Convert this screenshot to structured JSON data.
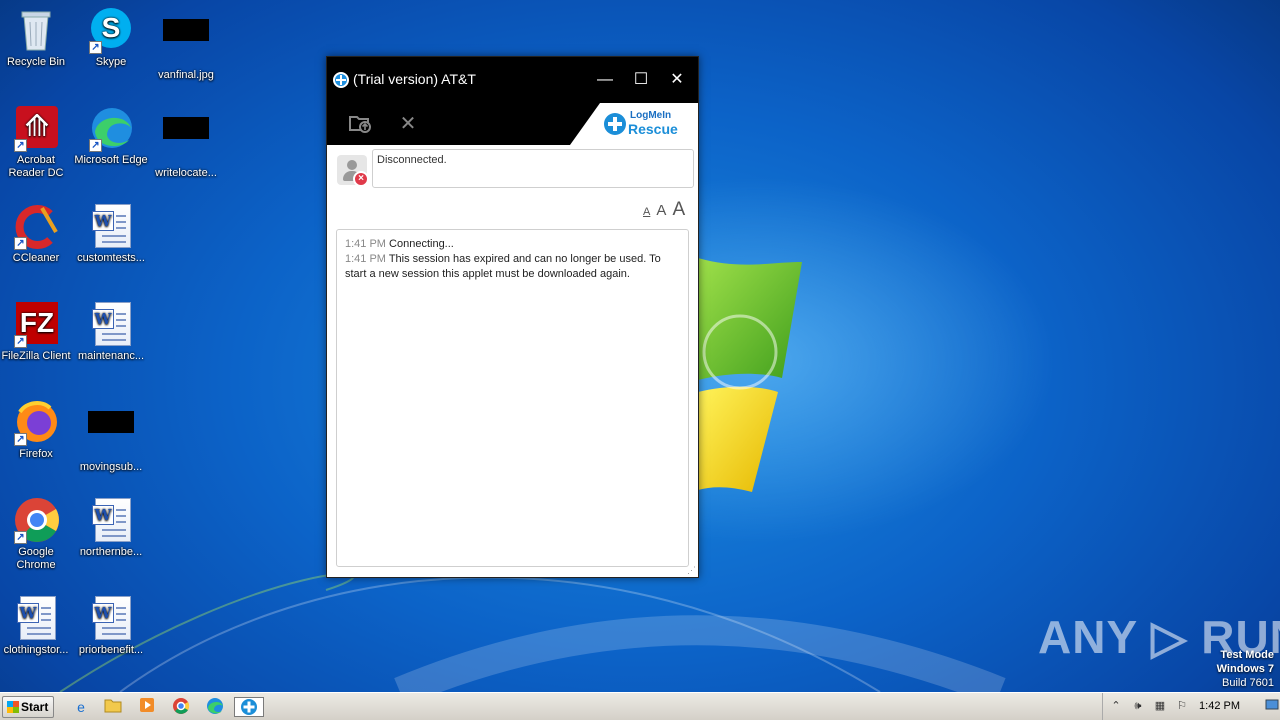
{
  "desktop": {
    "icons": [
      {
        "label": "Recycle Bin"
      },
      {
        "label": "Skype"
      },
      {
        "label": "vanfinal.jpg"
      },
      {
        "label": "Acrobat Reader DC"
      },
      {
        "label": "Microsoft Edge"
      },
      {
        "label": "writelocate..."
      },
      {
        "label": "CCleaner"
      },
      {
        "label": "customtests..."
      },
      {
        "label": "FileZilla Client"
      },
      {
        "label": "maintenanc..."
      },
      {
        "label": "Firefox"
      },
      {
        "label": "movingsub..."
      },
      {
        "label": "Google Chrome"
      },
      {
        "label": "northernbe..."
      },
      {
        "label": "clothingstor..."
      },
      {
        "label": "priorbenefit..."
      }
    ]
  },
  "window": {
    "title": "(Trial version) AT&T",
    "minimize_glyph": "—",
    "maximize_glyph": "☐",
    "close_glyph": "✕",
    "brand_top": "LogMeIn",
    "brand_bottom": "Rescue",
    "status": "Disconnected.",
    "font_sizes": [
      "A",
      "A",
      "A"
    ],
    "log": [
      {
        "time": "1:41 PM",
        "text": "Connecting..."
      },
      {
        "time": "1:41 PM",
        "text": "This session has expired and can no longer be used. To start a new session this applet must be downloaded again."
      }
    ]
  },
  "watermark": {
    "brand": "ANY ▷ RUN",
    "test_mode": "Test Mode",
    "os": "Windows 7",
    "build": "Build 7601"
  },
  "taskbar": {
    "start_label": "Start",
    "clock": "1:42 PM"
  },
  "colors": {
    "desktop_blue": "#0c63c8",
    "titlebar": "#000000",
    "brand_blue": "#1b8ed8",
    "error_red": "#e03a4a"
  }
}
